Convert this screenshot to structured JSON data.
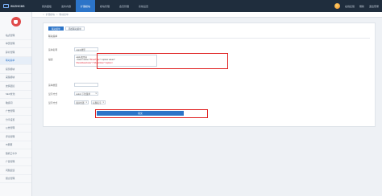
{
  "topbar": {
    "logo_text": "WUZHICMS",
    "nav": [
      {
        "label": "我的面板"
      },
      {
        "label": "发布内容"
      },
      {
        "label": "扩展模块"
      },
      {
        "label": "模块管理"
      },
      {
        "label": "会员管理"
      },
      {
        "label": "系统设置"
      }
    ],
    "active_nav": 2,
    "right": [
      "在线反馈",
      "刷新",
      "退出登录"
    ]
  },
  "sidebar": {
    "items": [
      "站点管理",
      "单页管理",
      "碎片管理",
      "联动菜单",
      "投票模块",
      "采集模块",
      "友情链接",
      "SEO优化",
      "敏感词",
      "广告管理",
      "分享设置",
      "公告管理",
      "评论管理",
      "IP屏蔽",
      "随机口令卡",
      "广告管理",
      "问题反馈",
      "留言管理"
    ],
    "active_index": 3
  },
  "breadcrumb": {
    "sep": ">",
    "items": [
      "扩展模块",
      "联动菜单"
    ]
  },
  "tabs": [
    {
      "label": "联动菜单"
    },
    {
      "label": "添加联动菜单"
    }
  ],
  "form": {
    "section_title": "联动菜单",
    "name_label": "菜单名称",
    "name_value": "apply类型",
    "desc_label": "描述",
    "desc_line1": "apply类型分",
    "desc_line2a": "<select name=\"",
    "desc_line2b": "ShowType",
    "desc_line2c": "\"><option value=\"",
    "desc_line3": "ShowClassCode\">\"ShowOrder\"</option>",
    "type_label": "菜单类型",
    "type_value": "",
    "display_label": "显示方式",
    "display_value": "select 下拉菜单",
    "style_label": "显示方式",
    "style_values": [
      "展示位置",
      "标题名字"
    ],
    "submit_label": "提交"
  },
  "colors": {
    "accent": "#2c74c8",
    "highlight_box": "#e02424",
    "topbar": "#1f2d3d"
  }
}
